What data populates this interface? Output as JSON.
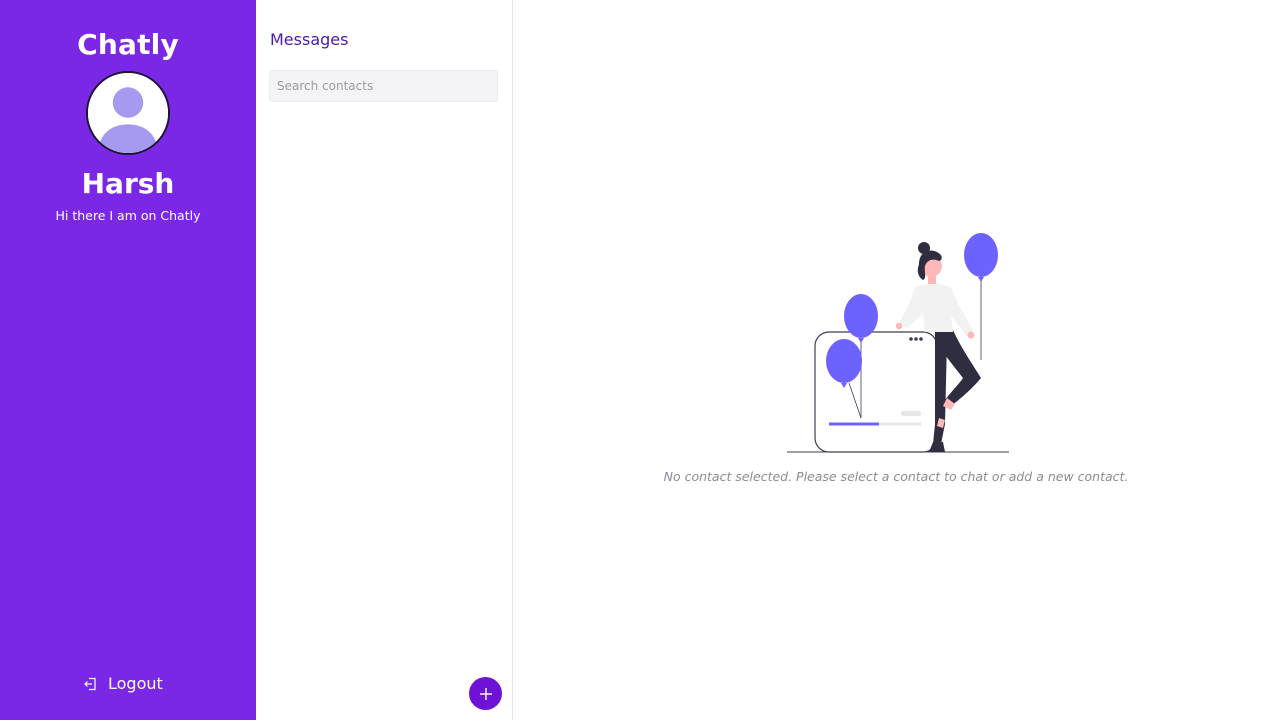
{
  "sidebar": {
    "brand": "Chatly",
    "user_name": "Harsh",
    "user_status": "Hi there I am on Chatly",
    "logout_label": "Logout"
  },
  "contacts": {
    "title": "Messages",
    "search_placeholder": "Search contacts",
    "search_value": ""
  },
  "main": {
    "empty_message": "No contact selected. Please select a contact to chat or add a new contact."
  },
  "icons": {
    "logout": "logout-icon",
    "add": "plus-icon",
    "avatar": "user-avatar-icon"
  },
  "colors": {
    "sidebar_bg": "#7a28e6",
    "accent": "#6d12d6",
    "title_text": "#4a1aa8",
    "balloon": "#6c63ff"
  }
}
